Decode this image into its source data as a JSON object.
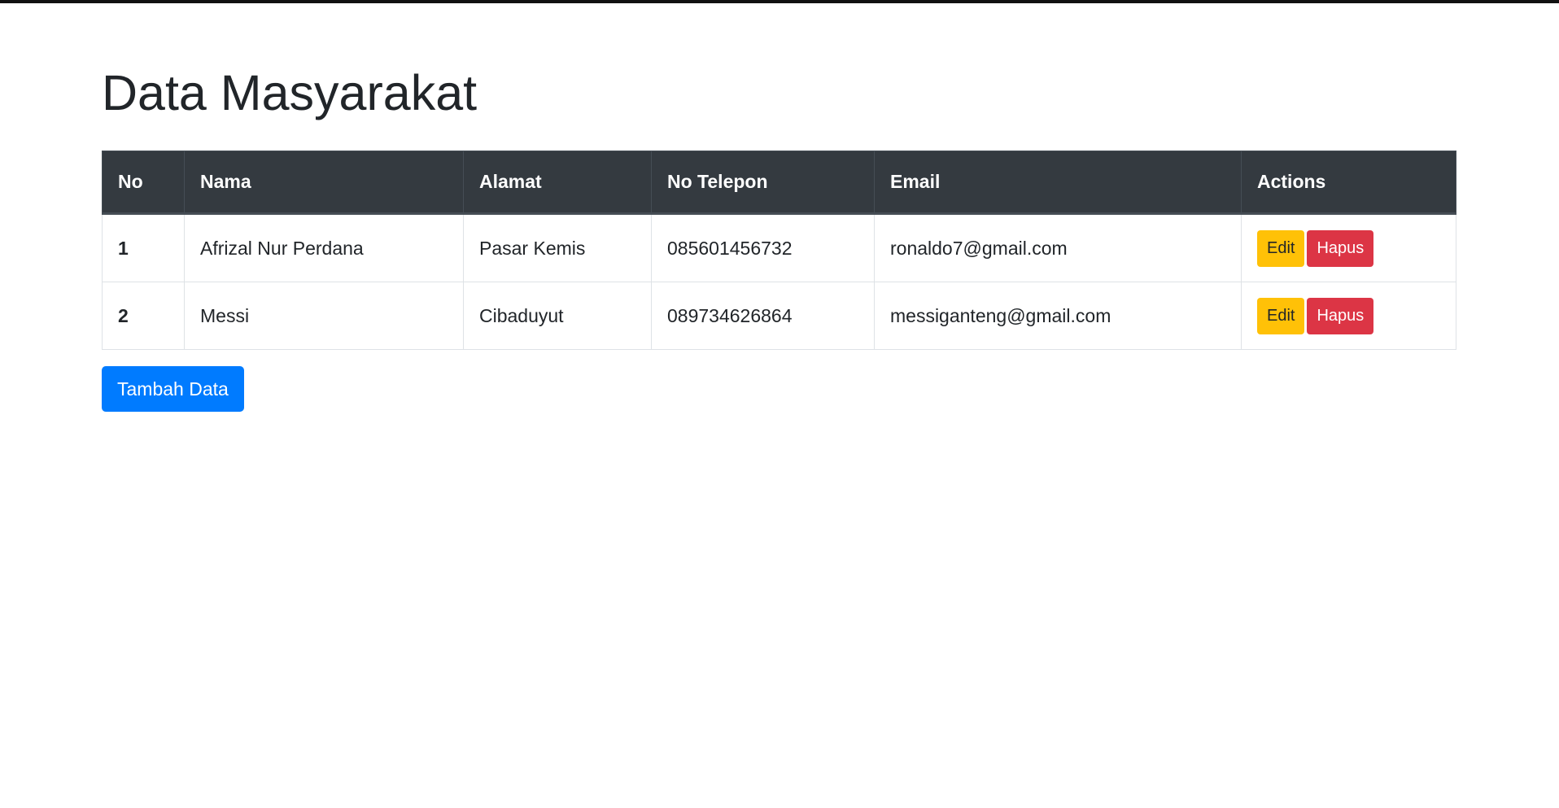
{
  "page": {
    "title": "Data Masyarakat"
  },
  "table": {
    "headers": [
      "No",
      "Nama",
      "Alamat",
      "No Telepon",
      "Email",
      "Actions"
    ],
    "rows": [
      {
        "no": "1",
        "nama": "Afrizal Nur Perdana",
        "alamat": "Pasar Kemis",
        "telepon": "085601456732",
        "email": "ronaldo7@gmail.com"
      },
      {
        "no": "2",
        "nama": "Messi",
        "alamat": "Cibaduyut",
        "telepon": "089734626864",
        "email": "messiganteng@gmail.com"
      }
    ],
    "edit_label": "Edit",
    "delete_label": "Hapus"
  },
  "actions": {
    "add_label": "Tambah Data"
  },
  "colors": {
    "header_bg": "#343a40",
    "edit": "#ffc107",
    "delete": "#dc3545",
    "primary": "#007bff"
  }
}
